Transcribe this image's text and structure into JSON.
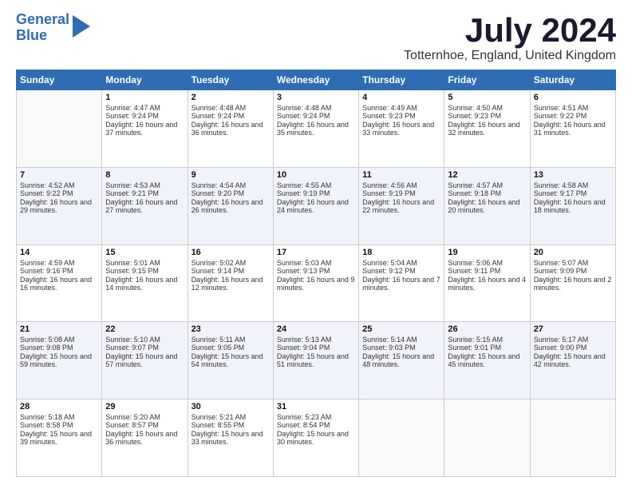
{
  "logo": {
    "line1": "General",
    "line2": "Blue"
  },
  "title": "July 2024",
  "location": "Totternhoe, England, United Kingdom",
  "weekdays": [
    "Sunday",
    "Monday",
    "Tuesday",
    "Wednesday",
    "Thursday",
    "Friday",
    "Saturday"
  ],
  "weeks": [
    [
      {
        "day": "",
        "sunrise": "",
        "sunset": "",
        "daylight": ""
      },
      {
        "day": "1",
        "sunrise": "Sunrise: 4:47 AM",
        "sunset": "Sunset: 9:24 PM",
        "daylight": "Daylight: 16 hours and 37 minutes."
      },
      {
        "day": "2",
        "sunrise": "Sunrise: 4:48 AM",
        "sunset": "Sunset: 9:24 PM",
        "daylight": "Daylight: 16 hours and 36 minutes."
      },
      {
        "day": "3",
        "sunrise": "Sunrise: 4:48 AM",
        "sunset": "Sunset: 9:24 PM",
        "daylight": "Daylight: 16 hours and 35 minutes."
      },
      {
        "day": "4",
        "sunrise": "Sunrise: 4:49 AM",
        "sunset": "Sunset: 9:23 PM",
        "daylight": "Daylight: 16 hours and 33 minutes."
      },
      {
        "day": "5",
        "sunrise": "Sunrise: 4:50 AM",
        "sunset": "Sunset: 9:23 PM",
        "daylight": "Daylight: 16 hours and 32 minutes."
      },
      {
        "day": "6",
        "sunrise": "Sunrise: 4:51 AM",
        "sunset": "Sunset: 9:22 PM",
        "daylight": "Daylight: 16 hours and 31 minutes."
      }
    ],
    [
      {
        "day": "7",
        "sunrise": "Sunrise: 4:52 AM",
        "sunset": "Sunset: 9:22 PM",
        "daylight": "Daylight: 16 hours and 29 minutes."
      },
      {
        "day": "8",
        "sunrise": "Sunrise: 4:53 AM",
        "sunset": "Sunset: 9:21 PM",
        "daylight": "Daylight: 16 hours and 27 minutes."
      },
      {
        "day": "9",
        "sunrise": "Sunrise: 4:54 AM",
        "sunset": "Sunset: 9:20 PM",
        "daylight": "Daylight: 16 hours and 26 minutes."
      },
      {
        "day": "10",
        "sunrise": "Sunrise: 4:55 AM",
        "sunset": "Sunset: 9:19 PM",
        "daylight": "Daylight: 16 hours and 24 minutes."
      },
      {
        "day": "11",
        "sunrise": "Sunrise: 4:56 AM",
        "sunset": "Sunset: 9:19 PM",
        "daylight": "Daylight: 16 hours and 22 minutes."
      },
      {
        "day": "12",
        "sunrise": "Sunrise: 4:57 AM",
        "sunset": "Sunset: 9:18 PM",
        "daylight": "Daylight: 16 hours and 20 minutes."
      },
      {
        "day": "13",
        "sunrise": "Sunrise: 4:58 AM",
        "sunset": "Sunset: 9:17 PM",
        "daylight": "Daylight: 16 hours and 18 minutes."
      }
    ],
    [
      {
        "day": "14",
        "sunrise": "Sunrise: 4:59 AM",
        "sunset": "Sunset: 9:16 PM",
        "daylight": "Daylight: 16 hours and 16 minutes."
      },
      {
        "day": "15",
        "sunrise": "Sunrise: 5:01 AM",
        "sunset": "Sunset: 9:15 PM",
        "daylight": "Daylight: 16 hours and 14 minutes."
      },
      {
        "day": "16",
        "sunrise": "Sunrise: 5:02 AM",
        "sunset": "Sunset: 9:14 PM",
        "daylight": "Daylight: 16 hours and 12 minutes."
      },
      {
        "day": "17",
        "sunrise": "Sunrise: 5:03 AM",
        "sunset": "Sunset: 9:13 PM",
        "daylight": "Daylight: 16 hours and 9 minutes."
      },
      {
        "day": "18",
        "sunrise": "Sunrise: 5:04 AM",
        "sunset": "Sunset: 9:12 PM",
        "daylight": "Daylight: 16 hours and 7 minutes."
      },
      {
        "day": "19",
        "sunrise": "Sunrise: 5:06 AM",
        "sunset": "Sunset: 9:11 PM",
        "daylight": "Daylight: 16 hours and 4 minutes."
      },
      {
        "day": "20",
        "sunrise": "Sunrise: 5:07 AM",
        "sunset": "Sunset: 9:09 PM",
        "daylight": "Daylight: 16 hours and 2 minutes."
      }
    ],
    [
      {
        "day": "21",
        "sunrise": "Sunrise: 5:08 AM",
        "sunset": "Sunset: 9:08 PM",
        "daylight": "Daylight: 15 hours and 59 minutes."
      },
      {
        "day": "22",
        "sunrise": "Sunrise: 5:10 AM",
        "sunset": "Sunset: 9:07 PM",
        "daylight": "Daylight: 15 hours and 57 minutes."
      },
      {
        "day": "23",
        "sunrise": "Sunrise: 5:11 AM",
        "sunset": "Sunset: 9:05 PM",
        "daylight": "Daylight: 15 hours and 54 minutes."
      },
      {
        "day": "24",
        "sunrise": "Sunrise: 5:13 AM",
        "sunset": "Sunset: 9:04 PM",
        "daylight": "Daylight: 15 hours and 51 minutes."
      },
      {
        "day": "25",
        "sunrise": "Sunrise: 5:14 AM",
        "sunset": "Sunset: 9:03 PM",
        "daylight": "Daylight: 15 hours and 48 minutes."
      },
      {
        "day": "26",
        "sunrise": "Sunrise: 5:15 AM",
        "sunset": "Sunset: 9:01 PM",
        "daylight": "Daylight: 15 hours and 45 minutes."
      },
      {
        "day": "27",
        "sunrise": "Sunrise: 5:17 AM",
        "sunset": "Sunset: 9:00 PM",
        "daylight": "Daylight: 15 hours and 42 minutes."
      }
    ],
    [
      {
        "day": "28",
        "sunrise": "Sunrise: 5:18 AM",
        "sunset": "Sunset: 8:58 PM",
        "daylight": "Daylight: 15 hours and 39 minutes."
      },
      {
        "day": "29",
        "sunrise": "Sunrise: 5:20 AM",
        "sunset": "Sunset: 8:57 PM",
        "daylight": "Daylight: 15 hours and 36 minutes."
      },
      {
        "day": "30",
        "sunrise": "Sunrise: 5:21 AM",
        "sunset": "Sunset: 8:55 PM",
        "daylight": "Daylight: 15 hours and 33 minutes."
      },
      {
        "day": "31",
        "sunrise": "Sunrise: 5:23 AM",
        "sunset": "Sunset: 8:54 PM",
        "daylight": "Daylight: 15 hours and 30 minutes."
      },
      {
        "day": "",
        "sunrise": "",
        "sunset": "",
        "daylight": ""
      },
      {
        "day": "",
        "sunrise": "",
        "sunset": "",
        "daylight": ""
      },
      {
        "day": "",
        "sunrise": "",
        "sunset": "",
        "daylight": ""
      }
    ]
  ]
}
